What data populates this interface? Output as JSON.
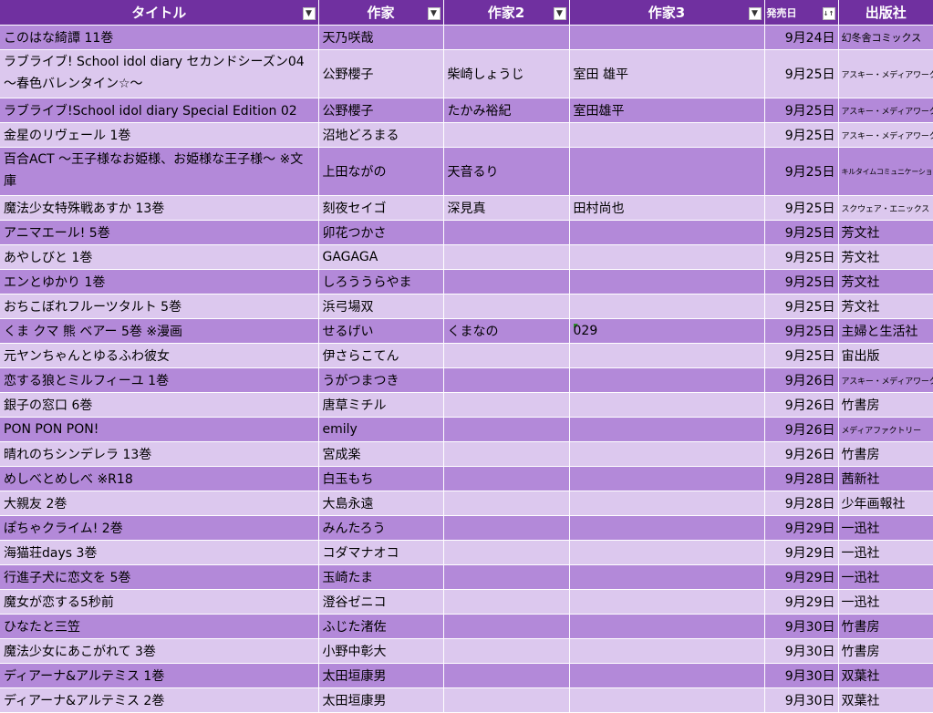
{
  "headers": {
    "title": "タイトル",
    "author1": "作家",
    "author2": "作家2",
    "author3": "作家3",
    "release": "発売日",
    "publisher": "出版社",
    "filter_glyph": "▼",
    "sort_glyph": "↓↑"
  },
  "rows": [
    {
      "title": "このはな綺譚 11巻",
      "a1": "天乃咲哉",
      "a2": "",
      "a3": "",
      "date": "9月24日",
      "pub": "幻冬舎コミックス"
    },
    {
      "title": "ラブライブ! School idol diary セカンドシーズン04 ～春色バレンタイン☆～",
      "a1": "公野櫻子",
      "a2": "柴崎しょうじ",
      "a3": "室田 雄平",
      "date": "9月25日",
      "pub": "アスキー・メディアワークス"
    },
    {
      "title": "ラブライブ!School idol diary Special Edition 02",
      "a1": "公野櫻子",
      "a2": "たかみ裕紀",
      "a3": "室田雄平",
      "date": "9月25日",
      "pub": "アスキー・メディアワークス"
    },
    {
      "title": "金星のリヴェール 1巻",
      "a1": "沼地どろまる",
      "a2": "",
      "a3": "",
      "date": "9月25日",
      "pub": "アスキー・メディアワークス"
    },
    {
      "title": "百合ACT ～王子様なお姫様、お姫様な王子様～ ※文庫",
      "a1": "上田ながの",
      "a2": "天音るり",
      "a3": "",
      "date": "9月25日",
      "pub": "キルタイムコミュニケーション"
    },
    {
      "title": "魔法少女特殊戦あすか 13巻",
      "a1": "刻夜セイゴ",
      "a2": "深見真",
      "a3": "田村尚也",
      "date": "9月25日",
      "pub": "スクウェア・エニックス"
    },
    {
      "title": "アニマエール! 5巻",
      "a1": "卯花つかさ",
      "a2": "",
      "a3": "",
      "date": "9月25日",
      "pub": "芳文社"
    },
    {
      "title": "あやしびと 1巻",
      "a1": "GAGAGA",
      "a2": "",
      "a3": "",
      "date": "9月25日",
      "pub": "芳文社"
    },
    {
      "title": "エンとゆかり 1巻",
      "a1": "しろううらやま",
      "a2": "",
      "a3": "",
      "date": "9月25日",
      "pub": "芳文社"
    },
    {
      "title": "おちこぼれフルーツタルト 5巻",
      "a1": "浜弓場双",
      "a2": "",
      "a3": "",
      "date": "9月25日",
      "pub": "芳文社"
    },
    {
      "title": "くま クマ 熊 ベアー 5巻 ※漫画",
      "a1": "せるげい",
      "a2": "くまなの",
      "a3": "029",
      "date": "9月25日",
      "pub": "主婦と生活社"
    },
    {
      "title": "元ヤンちゃんとゆるふわ彼女",
      "a1": "伊さらこてん",
      "a2": "",
      "a3": "",
      "date": "9月25日",
      "pub": "宙出版"
    },
    {
      "title": "恋する狼とミルフィーユ 1巻",
      "a1": "うがつまつき",
      "a2": "",
      "a3": "",
      "date": "9月26日",
      "pub": "アスキー・メディアワークス"
    },
    {
      "title": "銀子の窓口 6巻",
      "a1": "唐草ミチル",
      "a2": "",
      "a3": "",
      "date": "9月26日",
      "pub": "竹書房"
    },
    {
      "title": "PON PON PON!",
      "a1": "emily",
      "a2": "",
      "a3": "",
      "date": "9月26日",
      "pub": "メディアファクトリー"
    },
    {
      "title": "晴れのちシンデレラ 13巻",
      "a1": "宮成楽",
      "a2": "",
      "a3": "",
      "date": "9月26日",
      "pub": "竹書房"
    },
    {
      "title": "めしべとめしべ ※R18",
      "a1": "白玉もち",
      "a2": "",
      "a3": "",
      "date": "9月28日",
      "pub": "茜新社"
    },
    {
      "title": "大親友 2巻",
      "a1": "大島永遠",
      "a2": "",
      "a3": "",
      "date": "9月28日",
      "pub": "少年画報社"
    },
    {
      "title": "ぽちゃクライム! 2巻",
      "a1": "みんたろう",
      "a2": "",
      "a3": "",
      "date": "9月29日",
      "pub": "一迅社"
    },
    {
      "title": "海猫荘days 3巻",
      "a1": "コダマナオコ",
      "a2": "",
      "a3": "",
      "date": "9月29日",
      "pub": "一迅社"
    },
    {
      "title": "行進子犬に恋文を 5巻",
      "a1": "玉崎たま",
      "a2": "",
      "a3": "",
      "date": "9月29日",
      "pub": "一迅社"
    },
    {
      "title": "魔女が恋する5秒前",
      "a1": "澄谷ゼニコ",
      "a2": "",
      "a3": "",
      "date": "9月29日",
      "pub": "一迅社"
    },
    {
      "title": "ひなたと三笠",
      "a1": "ふじた渚佐",
      "a2": "",
      "a3": "",
      "date": "9月30日",
      "pub": "竹書房"
    },
    {
      "title": "魔法少女にあこがれて 3巻",
      "a1": "小野中彰大",
      "a2": "",
      "a3": "",
      "date": "9月30日",
      "pub": "竹書房"
    },
    {
      "title": "ディアーナ&アルテミス 1巻",
      "a1": "太田垣康男",
      "a2": "",
      "a3": "",
      "date": "9月30日",
      "pub": "双葉社"
    },
    {
      "title": "ディアーナ&アルテミス 2巻",
      "a1": "太田垣康男",
      "a2": "",
      "a3": "",
      "date": "9月30日",
      "pub": "双葉社"
    }
  ]
}
